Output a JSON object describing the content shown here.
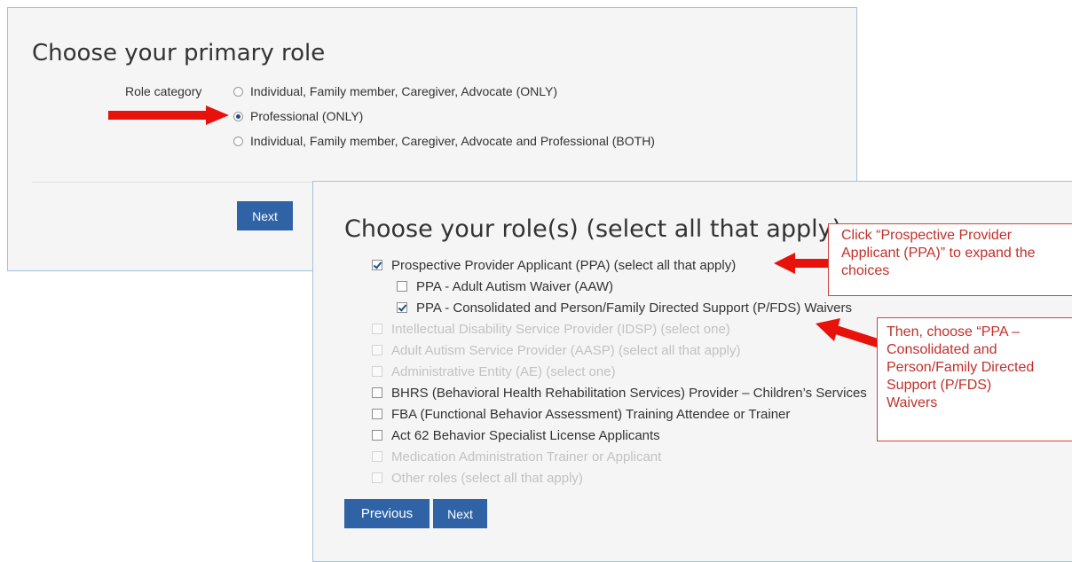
{
  "role_form": {
    "title": "Choose your primary role",
    "category_label": "Role category",
    "options": [
      {
        "label": "Individual, Family member, Caregiver, Advocate (ONLY)",
        "selected": false
      },
      {
        "label": "Professional (ONLY)",
        "selected": true
      },
      {
        "label": "Individual, Family member, Caregiver, Advocate and Professional (BOTH)",
        "selected": false
      }
    ],
    "next_label": "Next"
  },
  "roles_form": {
    "title": "Choose your role(s) (select all that apply)",
    "items": [
      {
        "label": "Prospective Provider Applicant (PPA) (select all that apply)",
        "checked": true,
        "disabled": false,
        "indent": false
      },
      {
        "label": "PPA - Adult Autism Waiver (AAW)",
        "checked": false,
        "disabled": false,
        "indent": true
      },
      {
        "label": "PPA - Consolidated and Person/Family Directed Support (P/FDS) Waivers",
        "checked": true,
        "disabled": false,
        "indent": true
      },
      {
        "label": "Intellectual Disability Service Provider (IDSP) (select one)",
        "checked": false,
        "disabled": true,
        "indent": false
      },
      {
        "label": "Adult Autism Service Provider (AASP) (select all that apply)",
        "checked": false,
        "disabled": true,
        "indent": false
      },
      {
        "label": "Administrative Entity (AE) (select one)",
        "checked": false,
        "disabled": true,
        "indent": false
      },
      {
        "label": "BHRS (Behavioral Health Rehabilitation Services) Provider – Children’s Services",
        "checked": false,
        "disabled": false,
        "indent": false
      },
      {
        "label": "FBA (Functional Behavior Assessment) Training Attendee or Trainer",
        "checked": false,
        "disabled": false,
        "indent": false
      },
      {
        "label": "Act 62 Behavior Specialist License Applicants",
        "checked": false,
        "disabled": false,
        "indent": false
      },
      {
        "label": "Medication Administration Trainer or Applicant",
        "checked": false,
        "disabled": true,
        "indent": false
      },
      {
        "label": "Other roles (select all that apply)",
        "checked": false,
        "disabled": true,
        "indent": false
      }
    ],
    "previous_label": "Previous",
    "next_label": "Next"
  },
  "annotations": {
    "callout_1_lines": [
      "Click “Prospective Provider",
      "Applicant (PPA)” to expand the",
      "choices"
    ],
    "callout_2_lines": [
      "Then, choose “PPA –",
      "Consolidated and",
      "Person/Family Directed",
      "Support (P/FDS)",
      "Waivers"
    ],
    "arrow_color": "#e8120c",
    "callout_color": "#c0302a"
  },
  "colors": {
    "button_bg": "#2f63a6",
    "panel_bg": "#f5f5f5",
    "panel_border": "#a9bfd6",
    "disabled_text": "#c2c2c2"
  }
}
